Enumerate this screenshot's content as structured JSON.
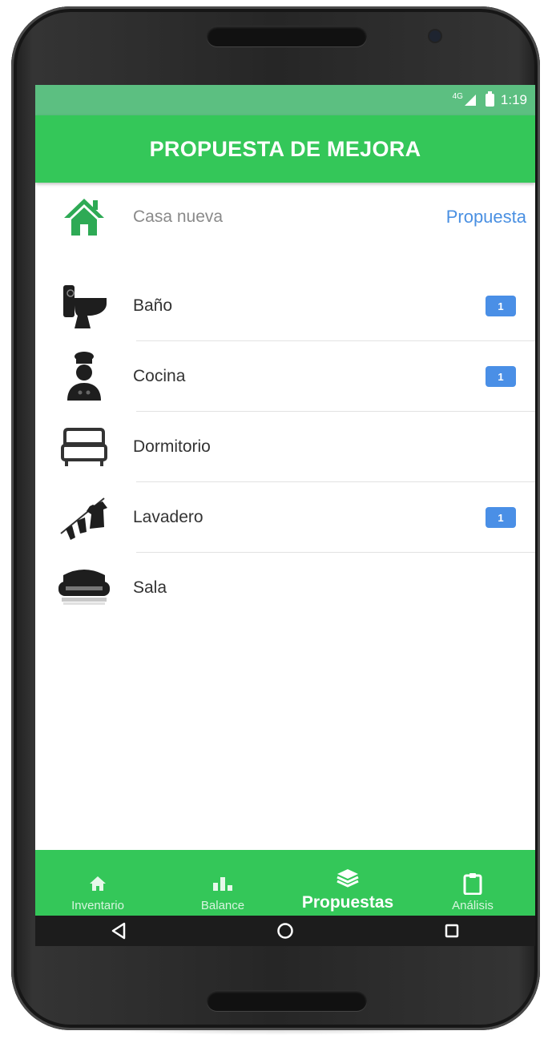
{
  "status_bar": {
    "network": "4G",
    "time": "1:19"
  },
  "app_bar": {
    "title": "PROPUESTA DE MEJORA"
  },
  "home": {
    "label": "Casa nueva",
    "link": "Propuesta",
    "icon": "house-icon"
  },
  "rooms": [
    {
      "label": "Baño",
      "badge": "1",
      "icon": "toilet-icon"
    },
    {
      "label": "Cocina",
      "badge": "1",
      "icon": "chef-icon"
    },
    {
      "label": "Dormitorio",
      "badge": "",
      "icon": "bed-icon"
    },
    {
      "label": "Lavadero",
      "badge": "1",
      "icon": "clothesline-icon"
    },
    {
      "label": "Sala",
      "badge": "",
      "icon": "sofa-icon"
    }
  ],
  "tabs": [
    {
      "label": "Inventario",
      "icon": "home-icon",
      "active": false
    },
    {
      "label": "Balance",
      "icon": "bar-chart-icon",
      "active": false
    },
    {
      "label": "Propuestas",
      "icon": "layers-icon",
      "active": true
    },
    {
      "label": "Análisis",
      "icon": "clipboard-icon",
      "active": false
    }
  ],
  "colors": {
    "primary": "#34c759",
    "status_bar": "#5cbf81",
    "link": "#4a90e2",
    "badge": "#4a8fe6",
    "home_icon": "#2eaa55"
  }
}
